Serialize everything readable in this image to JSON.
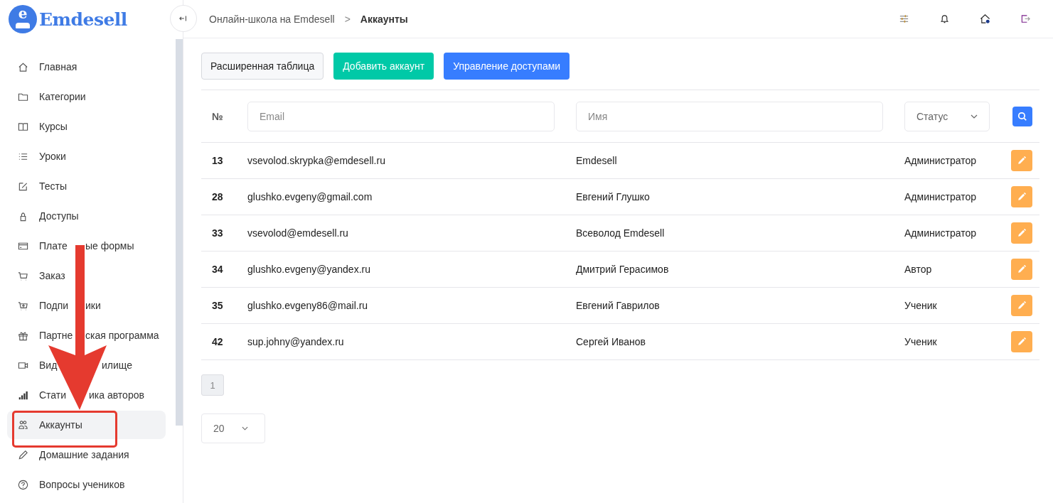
{
  "logo": {
    "mark": "e",
    "name": "Emdesell"
  },
  "breadcrumbs": [
    {
      "label": "Онлайн-школа на Emdesell",
      "current": false
    },
    {
      "label": "Аккаунты",
      "current": true
    }
  ],
  "breadcrumb_separator": ">",
  "sidebar": {
    "items": [
      {
        "label": "Главная",
        "kind": "home",
        "selected": false
      },
      {
        "label": "Категории",
        "kind": "folder",
        "selected": false
      },
      {
        "label": "Курсы",
        "kind": "book",
        "selected": false
      },
      {
        "label": "Уроки",
        "kind": "list",
        "selected": false
      },
      {
        "label": "Тесты",
        "kind": "edit",
        "selected": false
      },
      {
        "label": "Доступы",
        "kind": "lock",
        "selected": false
      },
      {
        "label_parts": [
          "Плате",
          "ые формы"
        ],
        "kind": "card",
        "selected": false
      },
      {
        "label": "Заказ",
        "kind": "cart",
        "selected": false
      },
      {
        "label_parts": [
          "Подпи",
          "ики"
        ],
        "kind": "cart-plus",
        "selected": false
      },
      {
        "label_parts": [
          "Партне",
          "ская программа"
        ],
        "kind": "gift",
        "selected": false
      },
      {
        "label_parts": [
          "Вид",
          "илище"
        ],
        "kind": "video",
        "selected": false
      },
      {
        "label_parts": [
          "Стати",
          "ика авторов"
        ],
        "kind": "bars",
        "selected": false
      },
      {
        "label": "Аккаунты",
        "kind": "users",
        "selected": true
      },
      {
        "label": "Домашние задания",
        "kind": "pencil",
        "selected": false
      },
      {
        "label": "Вопросы учеников",
        "kind": "question",
        "selected": false
      }
    ]
  },
  "toolbar": [
    {
      "label": "Расширенная таблица",
      "kind": "light"
    },
    {
      "label": "Добавить аккаунт",
      "kind": "green"
    },
    {
      "label": "Управление доступами",
      "kind": "blue"
    }
  ],
  "filters": {
    "number_heading": "№",
    "email": {
      "placeholder": "Email"
    },
    "name": {
      "placeholder": "Имя"
    },
    "status": {
      "value": "Статус"
    }
  },
  "rows": [
    {
      "number": "13",
      "email": "vsevolod.skrypka@emdesell.ru",
      "name": "Emdesell",
      "status": "Администратор"
    },
    {
      "number": "28",
      "email": "glushko.evgeny@gmail.com",
      "name": "Евгений Глушко",
      "status": "Администратор"
    },
    {
      "number": "33",
      "email": "vsevolod@emdesell.ru",
      "name": "Всеволод Emdesell",
      "status": "Администратор"
    },
    {
      "number": "34",
      "email": "glushko.evgeny@yandex.ru",
      "name": "Дмитрий Герасимов",
      "status": "Автор"
    },
    {
      "number": "35",
      "email": "glushko.evgeny86@mail.ru",
      "name": "Евгений Гаврилов",
      "status": "Ученик"
    },
    {
      "number": "42",
      "email": "sup.johny@yandex.ru",
      "name": "Сергей Иванов",
      "status": "Ученик"
    }
  ],
  "pagination": [
    {
      "label": "1",
      "selected": true
    }
  ],
  "per_page": {
    "value": "20"
  }
}
